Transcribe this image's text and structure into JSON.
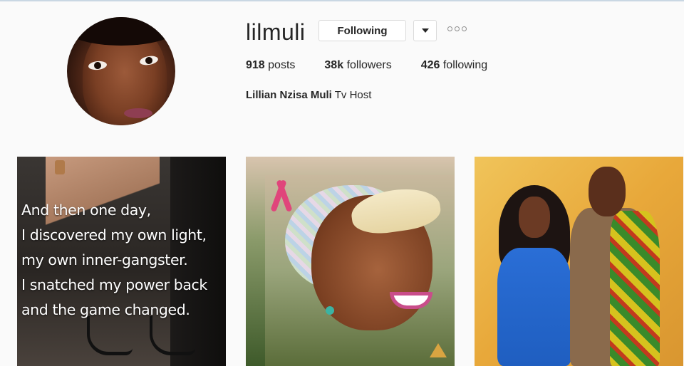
{
  "profile": {
    "username": "lilmuli",
    "follow_label": "Following",
    "posts_count": "918",
    "posts_label": "posts",
    "followers_count": "38k",
    "followers_label": "followers",
    "following_count": "426",
    "following_label": "following",
    "full_name": "Lillian Nzisa Muli",
    "bio": "Tv Host"
  },
  "posts": [
    {
      "quote": "And then one day,\nI discovered my own light,\nmy own inner-gangster.\nI snatched my power back\nand the game changed."
    },
    {},
    {}
  ],
  "icons": {
    "dropdown": "chevron-down-icon",
    "more": "more-options-icon"
  },
  "colors": {
    "background": "#fafafa",
    "text": "#262626",
    "border": "#dbdbdb"
  }
}
